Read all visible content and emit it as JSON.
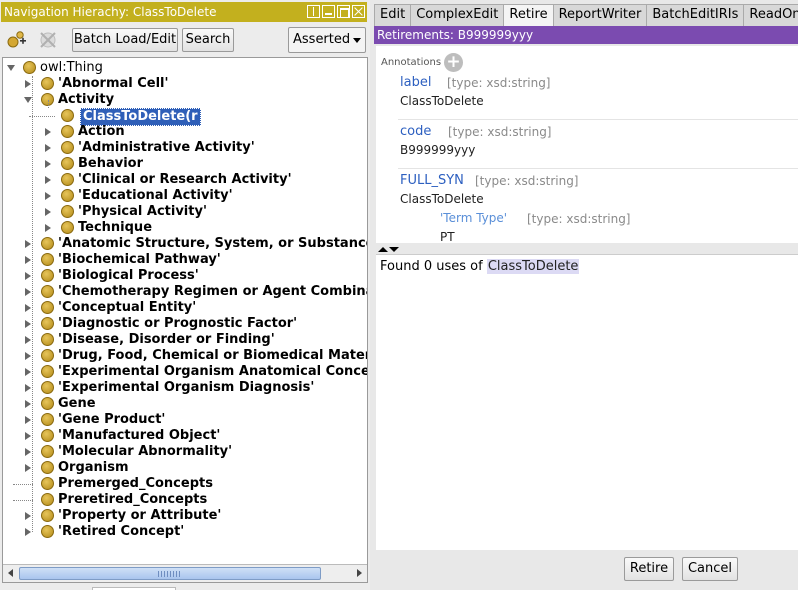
{
  "left_panel": {
    "title": "Navigation Hierachy: ClassToDelete",
    "toolbar": {
      "add_icon": "add-subclass-icon",
      "delete_icon": "delete-class-icon",
      "batch_label": "Batch Load/Edit",
      "search_label": "Search",
      "view_mode": "Asserted"
    },
    "tree": {
      "root": "owl:Thing",
      "nodes": [
        {
          "label": "'Abnormal Cell'",
          "expander": "closed"
        },
        {
          "label": "Activity",
          "expander": "open"
        },
        {
          "label": "ClassToDelete(r",
          "expander": "none",
          "selected": true
        },
        {
          "label": "Action",
          "expander": "closed"
        },
        {
          "label": "'Administrative Activity'",
          "expander": "closed"
        },
        {
          "label": "Behavior",
          "expander": "closed"
        },
        {
          "label": "'Clinical or Research Activity'",
          "expander": "closed"
        },
        {
          "label": "'Educational Activity'",
          "expander": "closed"
        },
        {
          "label": "'Physical Activity'",
          "expander": "closed"
        },
        {
          "label": "Technique",
          "expander": "closed"
        },
        {
          "label": "'Anatomic Structure, System, or Substance'",
          "expander": "closed"
        },
        {
          "label": "'Biochemical Pathway'",
          "expander": "closed"
        },
        {
          "label": "'Biological Process'",
          "expander": "closed"
        },
        {
          "label": "'Chemotherapy Regimen or Agent Combinat",
          "expander": "closed"
        },
        {
          "label": "'Conceptual Entity'",
          "expander": "closed"
        },
        {
          "label": "'Diagnostic or Prognostic Factor'",
          "expander": "closed"
        },
        {
          "label": "'Disease, Disorder or Finding'",
          "expander": "closed"
        },
        {
          "label": "'Drug, Food, Chemical or Biomedical Materia",
          "expander": "closed"
        },
        {
          "label": "'Experimental Organism Anatomical Concep",
          "expander": "closed"
        },
        {
          "label": "'Experimental Organism Diagnosis'",
          "expander": "closed"
        },
        {
          "label": "Gene",
          "expander": "closed"
        },
        {
          "label": "'Gene Product'",
          "expander": "closed"
        },
        {
          "label": "'Manufactured Object'",
          "expander": "closed"
        },
        {
          "label": "'Molecular Abnormality'",
          "expander": "closed"
        },
        {
          "label": "Organism",
          "expander": "closed"
        },
        {
          "label": "Premerged_Concepts",
          "expander": "none"
        },
        {
          "label": "Preretired_Concepts",
          "expander": "none"
        },
        {
          "label": "'Property or Attribute'",
          "expander": "closed"
        },
        {
          "label": "'Retired Concept'",
          "expander": "closed"
        }
      ]
    }
  },
  "right_panel": {
    "tabs": [
      "Edit",
      "ComplexEdit",
      "Retire",
      "ReportWriter",
      "BatchEditIRIs",
      "ReadOnly"
    ],
    "active_tab": "Retire",
    "header": "Retirements: B999999yyy",
    "annotations": {
      "title": "Annotations",
      "items": [
        {
          "property": "label",
          "type": "[type: xsd:string]",
          "value": "ClassToDelete"
        },
        {
          "property": "code",
          "type": "[type: xsd:string]",
          "value": "B999999yyy"
        },
        {
          "property": "FULL_SYN",
          "type": "[type: xsd:string]",
          "value": "ClassToDelete",
          "qualifier": {
            "property": "'Term Type'",
            "type": "[type: xsd:string]",
            "value": "PT"
          }
        }
      ]
    },
    "uses": {
      "prefix": "Found 0 uses of ",
      "entity": "ClassToDelete"
    },
    "buttons": {
      "retire": "Retire",
      "cancel": "Cancel"
    }
  },
  "colors": {
    "nav_title_bg": "#c3b01e",
    "retire_header_bg": "#7b4bb0",
    "selection_bg": "#2f5fb8",
    "property_blue": "#2c5fc0",
    "class_dot": "#d4a732"
  }
}
